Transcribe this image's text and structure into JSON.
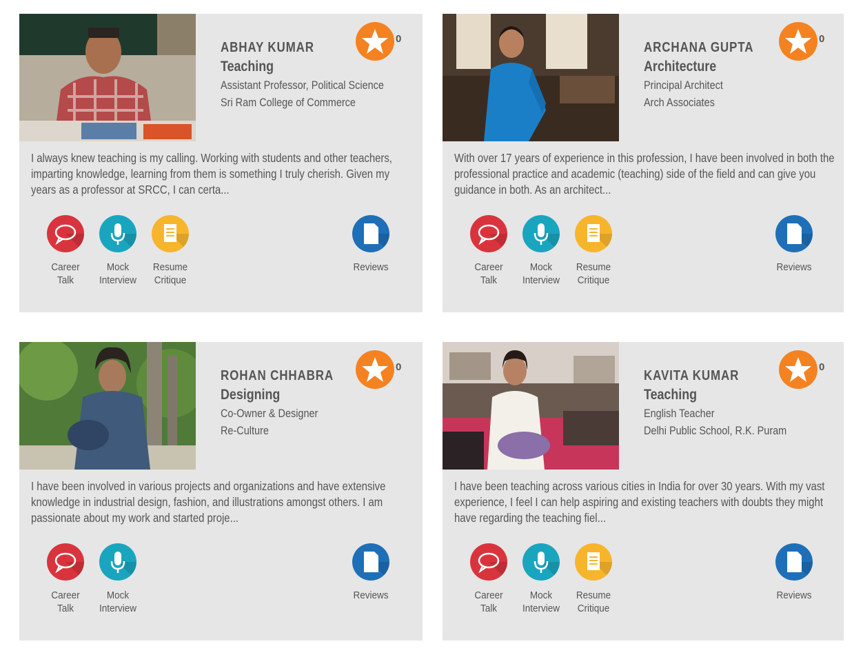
{
  "colors": {
    "card_bg": "#e6e6e6",
    "star": "#f58220",
    "career": "#d9343d",
    "mock": "#1aa5bf",
    "resume": "#f7b52c",
    "reviews": "#1e6fb8"
  },
  "cards": [
    {
      "name": "ABHAY KUMAR",
      "field": "Teaching",
      "role": "Assistant Professor, Political Science",
      "org": "Sri Ram College of Commerce",
      "stars": "0",
      "description": "I always knew teaching is my calling. Working with students and other teachers, imparting knowledge, learning from them is something I truly cherish. Given my years as a professor at SRCC, I can certa...",
      "services": {
        "career": "Career\nTalk",
        "mock": "Mock\nInterview",
        "resume": "Resume\nCritique"
      },
      "reviews": "Reviews"
    },
    {
      "name": "ARCHANA GUPTA",
      "field": "Architecture",
      "role": "Principal Architect",
      "org": "Arch Associates",
      "stars": "0",
      "description": "With over 17 years of experience in this profession, I have been involved in both the professional practice and academic (teaching) side of the field and can give you guidance in both. As an architect...",
      "services": {
        "career": "Career\nTalk",
        "mock": "Mock\nInterview",
        "resume": "Resume\nCritique"
      },
      "reviews": "Reviews"
    },
    {
      "name": "ROHAN CHHABRA",
      "field": "Designing",
      "role": "Co-Owner & Designer",
      "org": "Re-Culture",
      "stars": "0",
      "description": "I have been involved in various projects and organizations and have extensive knowledge in industrial design, fashion, and illustrations amongst others. I am passionate about my work and started proje...",
      "services": {
        "career": "Career\nTalk",
        "mock": "Mock\nInterview"
      },
      "reviews": "Reviews"
    },
    {
      "name": "KAVITA KUMAR",
      "field": "Teaching",
      "role": "English Teacher",
      "org": "Delhi Public School, R.K. Puram",
      "stars": "0",
      "description": "I have been teaching across various cities in India for over 30 years. With my vast experience, I feel I can help aspiring and existing teachers with doubts they might have regarding the teaching fiel...",
      "services": {
        "career": "Career\nTalk",
        "mock": "Mock\nInterview",
        "resume": "Resume\nCritique"
      },
      "reviews": "Reviews"
    }
  ]
}
